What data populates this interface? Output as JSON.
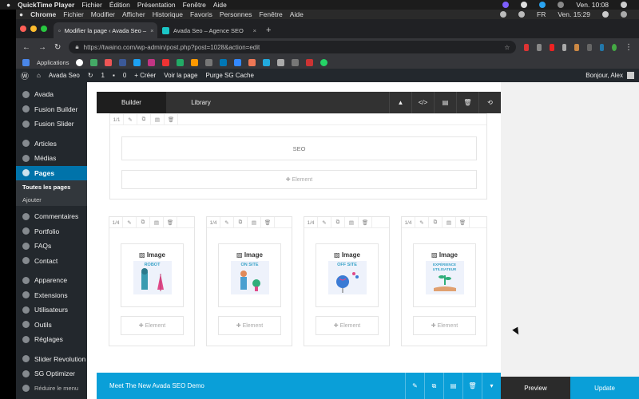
{
  "mac_menu": {
    "app": "QuickTime Player",
    "items": [
      "Fichier",
      "Édition",
      "Présentation",
      "Fenêtre",
      "Aide"
    ],
    "clock": "Ven. 10:08"
  },
  "mac_menu2": {
    "app": "Chrome",
    "items": [
      "Fichier",
      "Modifier",
      "Afficher",
      "Historique",
      "Favoris",
      "Personnes",
      "Fenêtre",
      "Aide"
    ],
    "flag": "FR",
    "clock": "Ven. 15:29"
  },
  "browser": {
    "tabs": [
      {
        "title": "Modifier la page ‹ Avada Seo –"
      },
      {
        "title": "Avada Seo – Agence SEO"
      }
    ],
    "url": "https://twaino.com/wp-admin/post.php?post=1028&action=edit",
    "bookmarks_label": "Applications"
  },
  "wp_admin_bar": {
    "site": "Avada Seo",
    "updates": "1",
    "comments": "0",
    "new": "+ Créer",
    "view": "Voir la page",
    "purge": "Purge SG Cache",
    "greeting": "Bonjour, Alex"
  },
  "sidebar": {
    "items": [
      {
        "label": "Avada"
      },
      {
        "label": "Fusion Builder"
      },
      {
        "label": "Fusion Slider"
      },
      {
        "label": "Articles"
      },
      {
        "label": "Médias"
      },
      {
        "label": "Pages"
      },
      {
        "label": "Commentaires"
      },
      {
        "label": "Portfolio"
      },
      {
        "label": "FAQs"
      },
      {
        "label": "Contact"
      },
      {
        "label": "Apparence"
      },
      {
        "label": "Extensions"
      },
      {
        "label": "Utilisateurs"
      },
      {
        "label": "Outils"
      },
      {
        "label": "Réglages"
      },
      {
        "label": "Slider Revolution"
      },
      {
        "label": "SG Optimizer"
      },
      {
        "label": "Réduire le menu"
      }
    ],
    "pages_sub": [
      "Toutes les pages",
      "Ajouter"
    ]
  },
  "builder": {
    "tab_builder": "Builder",
    "tab_library": "Library",
    "top_col_size": "1/1",
    "seo_label": "SEO",
    "element_label": "Element",
    "columns": [
      {
        "size": "1/4",
        "title": "Image",
        "tag": "ROBOT"
      },
      {
        "size": "1/4",
        "title": "Image",
        "tag": "ON SITE"
      },
      {
        "size": "1/4",
        "title": "Image",
        "tag": "OFF SITE"
      },
      {
        "size": "1/4",
        "title": "Image",
        "tag": "EXPÉRIENCE UTILISATEUR"
      }
    ],
    "bottom_container": "Meet The New Avada SEO Demo"
  },
  "actions": {
    "preview": "Preview",
    "update": "Update"
  },
  "colors": {
    "wp_dark": "#23282d",
    "wp_blue": "#0073aa",
    "avada_blue": "#0a9fd8"
  }
}
